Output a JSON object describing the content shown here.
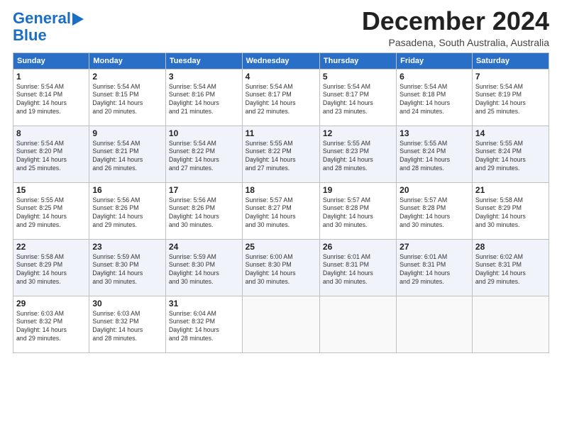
{
  "logo": {
    "line1": "General",
    "line2": "Blue"
  },
  "header": {
    "month_title": "December 2024",
    "location": "Pasadena, South Australia, Australia"
  },
  "weekdays": [
    "Sunday",
    "Monday",
    "Tuesday",
    "Wednesday",
    "Thursday",
    "Friday",
    "Saturday"
  ],
  "weeks": [
    [
      {
        "day": "1",
        "info": "Sunrise: 5:54 AM\nSunset: 8:14 PM\nDaylight: 14 hours\nand 19 minutes."
      },
      {
        "day": "2",
        "info": "Sunrise: 5:54 AM\nSunset: 8:15 PM\nDaylight: 14 hours\nand 20 minutes."
      },
      {
        "day": "3",
        "info": "Sunrise: 5:54 AM\nSunset: 8:16 PM\nDaylight: 14 hours\nand 21 minutes."
      },
      {
        "day": "4",
        "info": "Sunrise: 5:54 AM\nSunset: 8:17 PM\nDaylight: 14 hours\nand 22 minutes."
      },
      {
        "day": "5",
        "info": "Sunrise: 5:54 AM\nSunset: 8:17 PM\nDaylight: 14 hours\nand 23 minutes."
      },
      {
        "day": "6",
        "info": "Sunrise: 5:54 AM\nSunset: 8:18 PM\nDaylight: 14 hours\nand 24 minutes."
      },
      {
        "day": "7",
        "info": "Sunrise: 5:54 AM\nSunset: 8:19 PM\nDaylight: 14 hours\nand 25 minutes."
      }
    ],
    [
      {
        "day": "8",
        "info": "Sunrise: 5:54 AM\nSunset: 8:20 PM\nDaylight: 14 hours\nand 25 minutes."
      },
      {
        "day": "9",
        "info": "Sunrise: 5:54 AM\nSunset: 8:21 PM\nDaylight: 14 hours\nand 26 minutes."
      },
      {
        "day": "10",
        "info": "Sunrise: 5:54 AM\nSunset: 8:22 PM\nDaylight: 14 hours\nand 27 minutes."
      },
      {
        "day": "11",
        "info": "Sunrise: 5:55 AM\nSunset: 8:22 PM\nDaylight: 14 hours\nand 27 minutes."
      },
      {
        "day": "12",
        "info": "Sunrise: 5:55 AM\nSunset: 8:23 PM\nDaylight: 14 hours\nand 28 minutes."
      },
      {
        "day": "13",
        "info": "Sunrise: 5:55 AM\nSunset: 8:24 PM\nDaylight: 14 hours\nand 28 minutes."
      },
      {
        "day": "14",
        "info": "Sunrise: 5:55 AM\nSunset: 8:24 PM\nDaylight: 14 hours\nand 29 minutes."
      }
    ],
    [
      {
        "day": "15",
        "info": "Sunrise: 5:55 AM\nSunset: 8:25 PM\nDaylight: 14 hours\nand 29 minutes."
      },
      {
        "day": "16",
        "info": "Sunrise: 5:56 AM\nSunset: 8:26 PM\nDaylight: 14 hours\nand 29 minutes."
      },
      {
        "day": "17",
        "info": "Sunrise: 5:56 AM\nSunset: 8:26 PM\nDaylight: 14 hours\nand 30 minutes."
      },
      {
        "day": "18",
        "info": "Sunrise: 5:57 AM\nSunset: 8:27 PM\nDaylight: 14 hours\nand 30 minutes."
      },
      {
        "day": "19",
        "info": "Sunrise: 5:57 AM\nSunset: 8:28 PM\nDaylight: 14 hours\nand 30 minutes."
      },
      {
        "day": "20",
        "info": "Sunrise: 5:57 AM\nSunset: 8:28 PM\nDaylight: 14 hours\nand 30 minutes."
      },
      {
        "day": "21",
        "info": "Sunrise: 5:58 AM\nSunset: 8:29 PM\nDaylight: 14 hours\nand 30 minutes."
      }
    ],
    [
      {
        "day": "22",
        "info": "Sunrise: 5:58 AM\nSunset: 8:29 PM\nDaylight: 14 hours\nand 30 minutes."
      },
      {
        "day": "23",
        "info": "Sunrise: 5:59 AM\nSunset: 8:30 PM\nDaylight: 14 hours\nand 30 minutes."
      },
      {
        "day": "24",
        "info": "Sunrise: 5:59 AM\nSunset: 8:30 PM\nDaylight: 14 hours\nand 30 minutes."
      },
      {
        "day": "25",
        "info": "Sunrise: 6:00 AM\nSunset: 8:30 PM\nDaylight: 14 hours\nand 30 minutes."
      },
      {
        "day": "26",
        "info": "Sunrise: 6:01 AM\nSunset: 8:31 PM\nDaylight: 14 hours\nand 30 minutes."
      },
      {
        "day": "27",
        "info": "Sunrise: 6:01 AM\nSunset: 8:31 PM\nDaylight: 14 hours\nand 29 minutes."
      },
      {
        "day": "28",
        "info": "Sunrise: 6:02 AM\nSunset: 8:31 PM\nDaylight: 14 hours\nand 29 minutes."
      }
    ],
    [
      {
        "day": "29",
        "info": "Sunrise: 6:03 AM\nSunset: 8:32 PM\nDaylight: 14 hours\nand 29 minutes."
      },
      {
        "day": "30",
        "info": "Sunrise: 6:03 AM\nSunset: 8:32 PM\nDaylight: 14 hours\nand 28 minutes."
      },
      {
        "day": "31",
        "info": "Sunrise: 6:04 AM\nSunset: 8:32 PM\nDaylight: 14 hours\nand 28 minutes."
      },
      null,
      null,
      null,
      null
    ]
  ]
}
